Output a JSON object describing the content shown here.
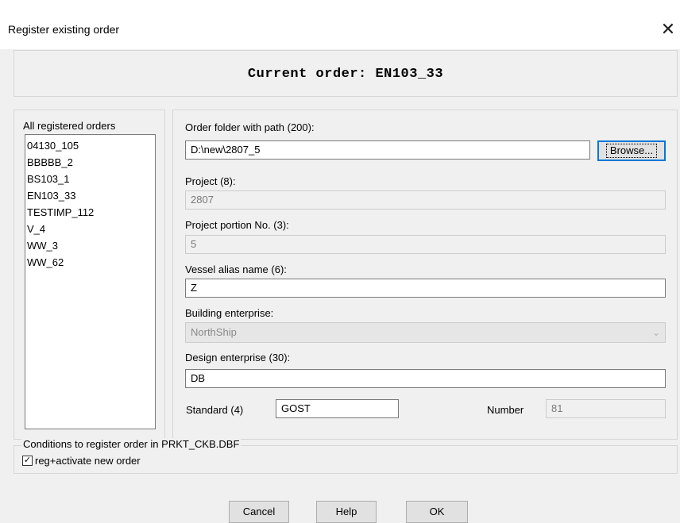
{
  "window": {
    "title": "Register existing order",
    "close_glyph": "✕"
  },
  "current_order": {
    "text": "Current order: EN103_33"
  },
  "orders": {
    "label": "All registered orders",
    "items": [
      "04130_105",
      "BBBBB_2",
      "BS103_1",
      "EN103_33",
      "TESTIMP_112",
      "V_4",
      "WW_3",
      "WW_62"
    ]
  },
  "form": {
    "folder_label": "Order folder with path (200):",
    "folder_value": "D:\\new\\2807_5",
    "browse_label": "Browse...",
    "project_label": "Project (8):",
    "project_value": "2807",
    "portion_label": "Project portion No. (3):",
    "portion_value": "5",
    "alias_label": "Vessel alias name (6):",
    "alias_value": "Z",
    "building_label": "Building enterprise:",
    "building_value": "NorthShip",
    "design_label": "Design enterprise (30):",
    "design_value": "DB",
    "standard_label": "Standard (4)",
    "standard_value": "GOST",
    "number_label": "Number",
    "number_value": "81"
  },
  "conditions": {
    "legend": "Conditions to register order in PRKT_CKB.DBF",
    "checkbox_label": "reg+activate new order",
    "checkbox_checked": true,
    "check_glyph": "✓"
  },
  "buttons": {
    "cancel": "Cancel",
    "help": "Help",
    "ok": "OK"
  }
}
